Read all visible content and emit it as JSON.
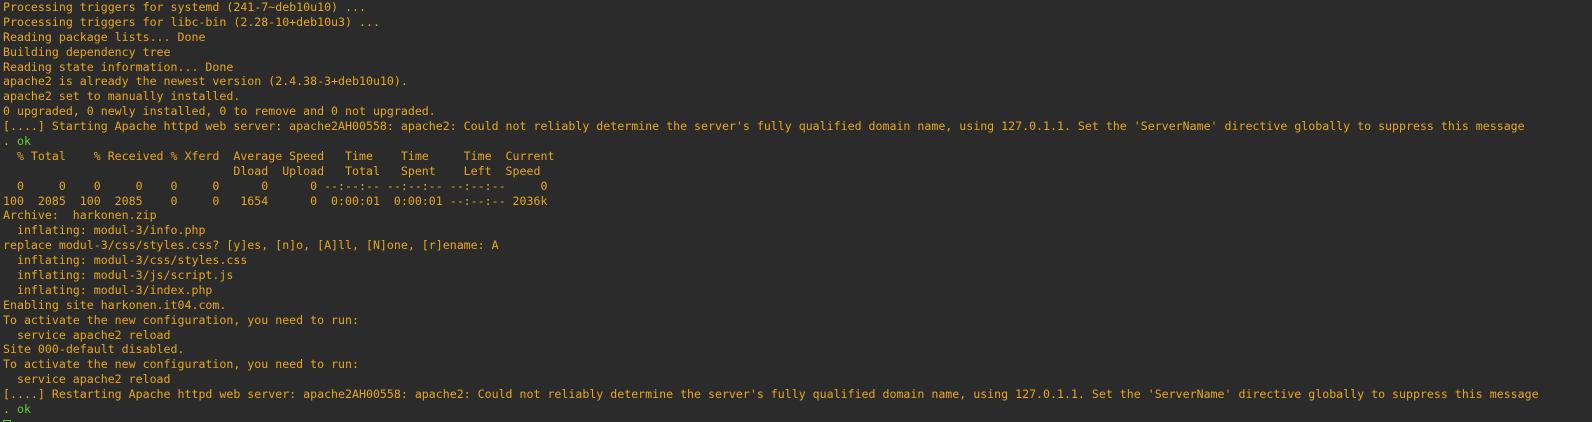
{
  "colors": {
    "background": "#2b2b2b",
    "text": "#e8a71c",
    "ok": "#5fd13b"
  },
  "terminal": {
    "lines": [
      [
        {
          "t": "Processing triggers for systemd (241-7~deb10u10) ...",
          "c": "text"
        }
      ],
      [
        {
          "t": "Processing triggers for libc-bin (2.28-10+deb10u3) ...",
          "c": "text"
        }
      ],
      [
        {
          "t": "Reading package lists... Done",
          "c": "text"
        }
      ],
      [
        {
          "t": "Building dependency tree",
          "c": "text"
        }
      ],
      [
        {
          "t": "Reading state information... Done",
          "c": "text"
        }
      ],
      [
        {
          "t": "apache2 is already the newest version (2.4.38-3+deb10u10).",
          "c": "text"
        }
      ],
      [
        {
          "t": "apache2 set to manually installed.",
          "c": "text"
        }
      ],
      [
        {
          "t": "0 upgraded, 0 newly installed, 0 to remove and 0 not upgraded.",
          "c": "text"
        }
      ],
      [
        {
          "t": "[....] Starting Apache httpd web server: apache2AH00558: apache2: Could not reliably determine the server's fully qualified domain name, using 127.0.1.1. Set the 'ServerName' directive globally to suppress this message",
          "c": "text"
        }
      ],
      [
        {
          "t": ". ",
          "c": "text"
        },
        {
          "t": "ok",
          "c": "ok"
        }
      ],
      [
        {
          "t": "  % Total    % Received % Xferd  Average Speed   Time    Time     Time  Current",
          "c": "text"
        }
      ],
      [
        {
          "t": "                                 Dload  Upload   Total   Spent    Left  Speed",
          "c": "text"
        }
      ],
      [
        {
          "t": "  0     0    0     0    0     0      0      0 --:--:-- --:--:-- --:--:--     0",
          "c": "text"
        }
      ],
      [
        {
          "t": "100  2085  100  2085    0     0   1654      0  0:00:01  0:00:01 --:--:-- 2036k",
          "c": "text"
        }
      ],
      [
        {
          "t": "Archive:  harkonen.zip",
          "c": "text"
        }
      ],
      [
        {
          "t": "  inflating: modul-3/info.php",
          "c": "text"
        }
      ],
      [
        {
          "t": "replace modul-3/css/styles.css? [y]es, [n]o, [A]ll, [N]one, [r]ename: A",
          "c": "text"
        }
      ],
      [
        {
          "t": "  inflating: modul-3/css/styles.css",
          "c": "text"
        }
      ],
      [
        {
          "t": "  inflating: modul-3/js/script.js",
          "c": "text"
        }
      ],
      [
        {
          "t": "  inflating: modul-3/index.php",
          "c": "text"
        }
      ],
      [
        {
          "t": "Enabling site harkonen.it04.com.",
          "c": "text"
        }
      ],
      [
        {
          "t": "To activate the new configuration, you need to run:",
          "c": "text"
        }
      ],
      [
        {
          "t": "  service apache2 reload",
          "c": "text"
        }
      ],
      [
        {
          "t": "Site 000-default disabled.",
          "c": "text"
        }
      ],
      [
        {
          "t": "To activate the new configuration, you need to run:",
          "c": "text"
        }
      ],
      [
        {
          "t": "  service apache2 reload",
          "c": "text"
        }
      ],
      [
        {
          "t": "[....] Restarting Apache httpd web server: apache2AH00558: apache2: Could not reliably determine the server's fully qualified domain name, using 127.0.1.1. Set the 'ServerName' directive globally to suppress this message",
          "c": "text"
        }
      ],
      [
        {
          "t": ". ",
          "c": "text"
        },
        {
          "t": "ok",
          "c": "ok"
        }
      ]
    ],
    "cursor_icon": "block-cursor-icon"
  }
}
